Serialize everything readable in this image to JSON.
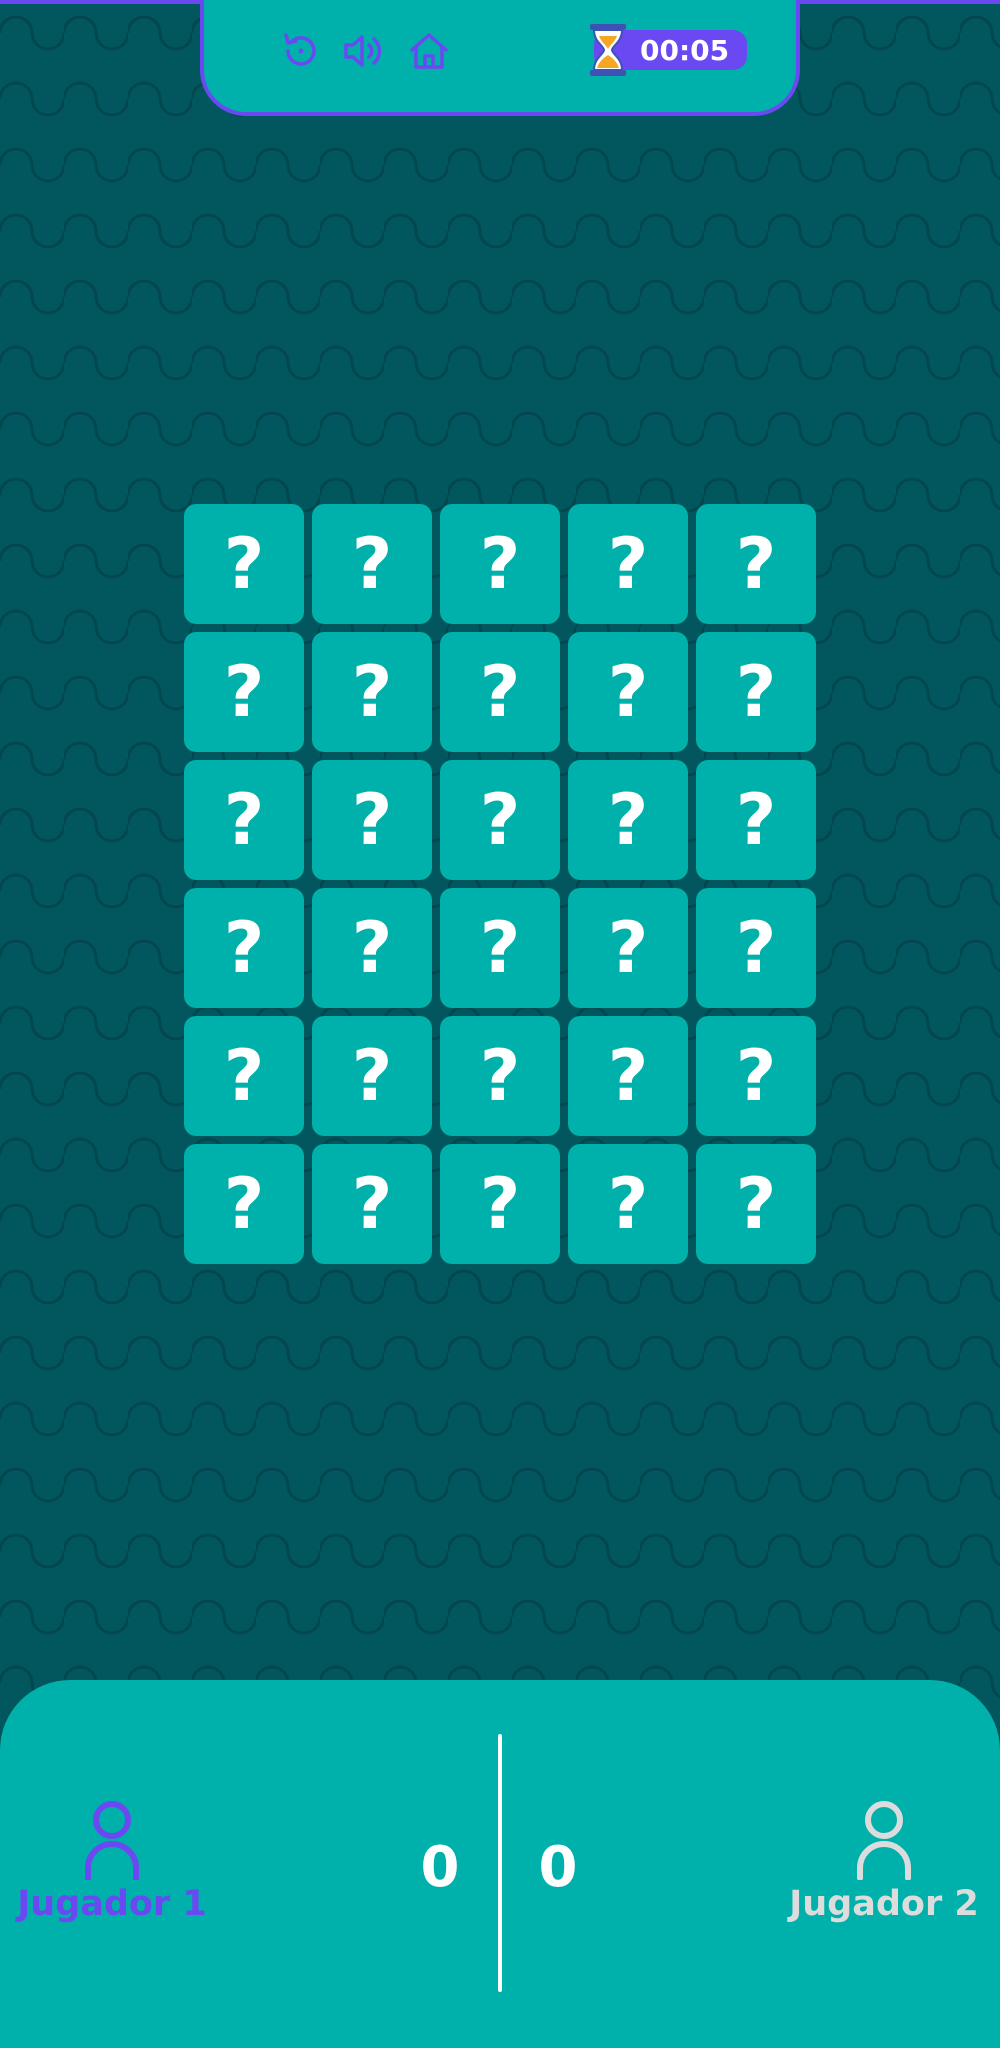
{
  "topbar": {
    "icons": [
      "restart-icon",
      "sound-icon",
      "home-icon",
      "hourglass-icon"
    ],
    "timer": "00:05"
  },
  "board": {
    "rows": 6,
    "columns": 5,
    "card_face": "?"
  },
  "players": [
    {
      "name": "Jugador 1",
      "score": "0",
      "active": true
    },
    {
      "name": "Jugador 2",
      "score": "0",
      "active": false
    }
  ],
  "colors": {
    "background": "#02575e",
    "panel": "#00b0aa",
    "accent": "#6a49f2",
    "inactive_player": "#dcdcdc",
    "text": "#ffffff"
  }
}
